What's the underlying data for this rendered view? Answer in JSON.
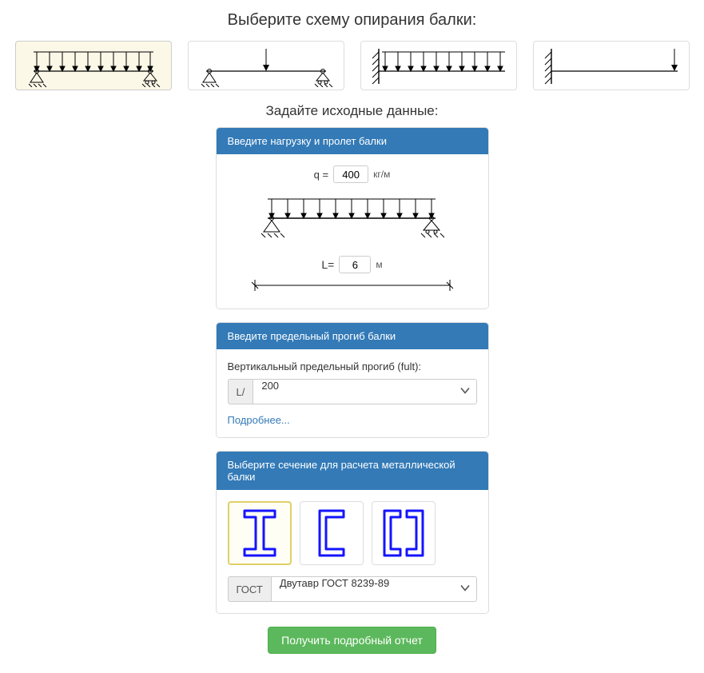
{
  "headings": {
    "select_scheme": "Выберите схему опирания балки:",
    "input_data": "Задайте исходные данные:"
  },
  "schemes": [
    {
      "id": "scheme-1",
      "type": "simply-supported-distributed",
      "selected": true
    },
    {
      "id": "scheme-2",
      "type": "simply-supported-point",
      "selected": false
    },
    {
      "id": "scheme-3",
      "type": "cantilever-distributed",
      "selected": false
    },
    {
      "id": "scheme-4",
      "type": "cantilever-point",
      "selected": false
    }
  ],
  "panel_load": {
    "title": "Введите нагрузку и пролет балки",
    "q_label": "q =",
    "q_value": "400",
    "q_unit": "кг/м",
    "L_label": "L=",
    "L_value": "6",
    "L_unit": "м"
  },
  "panel_deflection": {
    "title": "Введите предельный прогиб балки",
    "label": "Вертикальный предельный прогиб (fult):",
    "prefix": "L/",
    "value": "200",
    "more_link": "Подробнее..."
  },
  "panel_section": {
    "title": "Выберите сечение для расчета металлической балки",
    "sections": [
      {
        "id": "i-beam",
        "selected": true
      },
      {
        "id": "channel",
        "selected": false
      },
      {
        "id": "double-channel",
        "selected": false
      }
    ],
    "gost_prefix": "ГОСТ",
    "gost_value": "Двутавр ГОСТ 8239-89"
  },
  "submit": {
    "label": "Получить подробный отчет"
  },
  "colors": {
    "panel_header": "#337ab7",
    "button": "#5cb85c",
    "section_stroke": "#1414ff"
  }
}
